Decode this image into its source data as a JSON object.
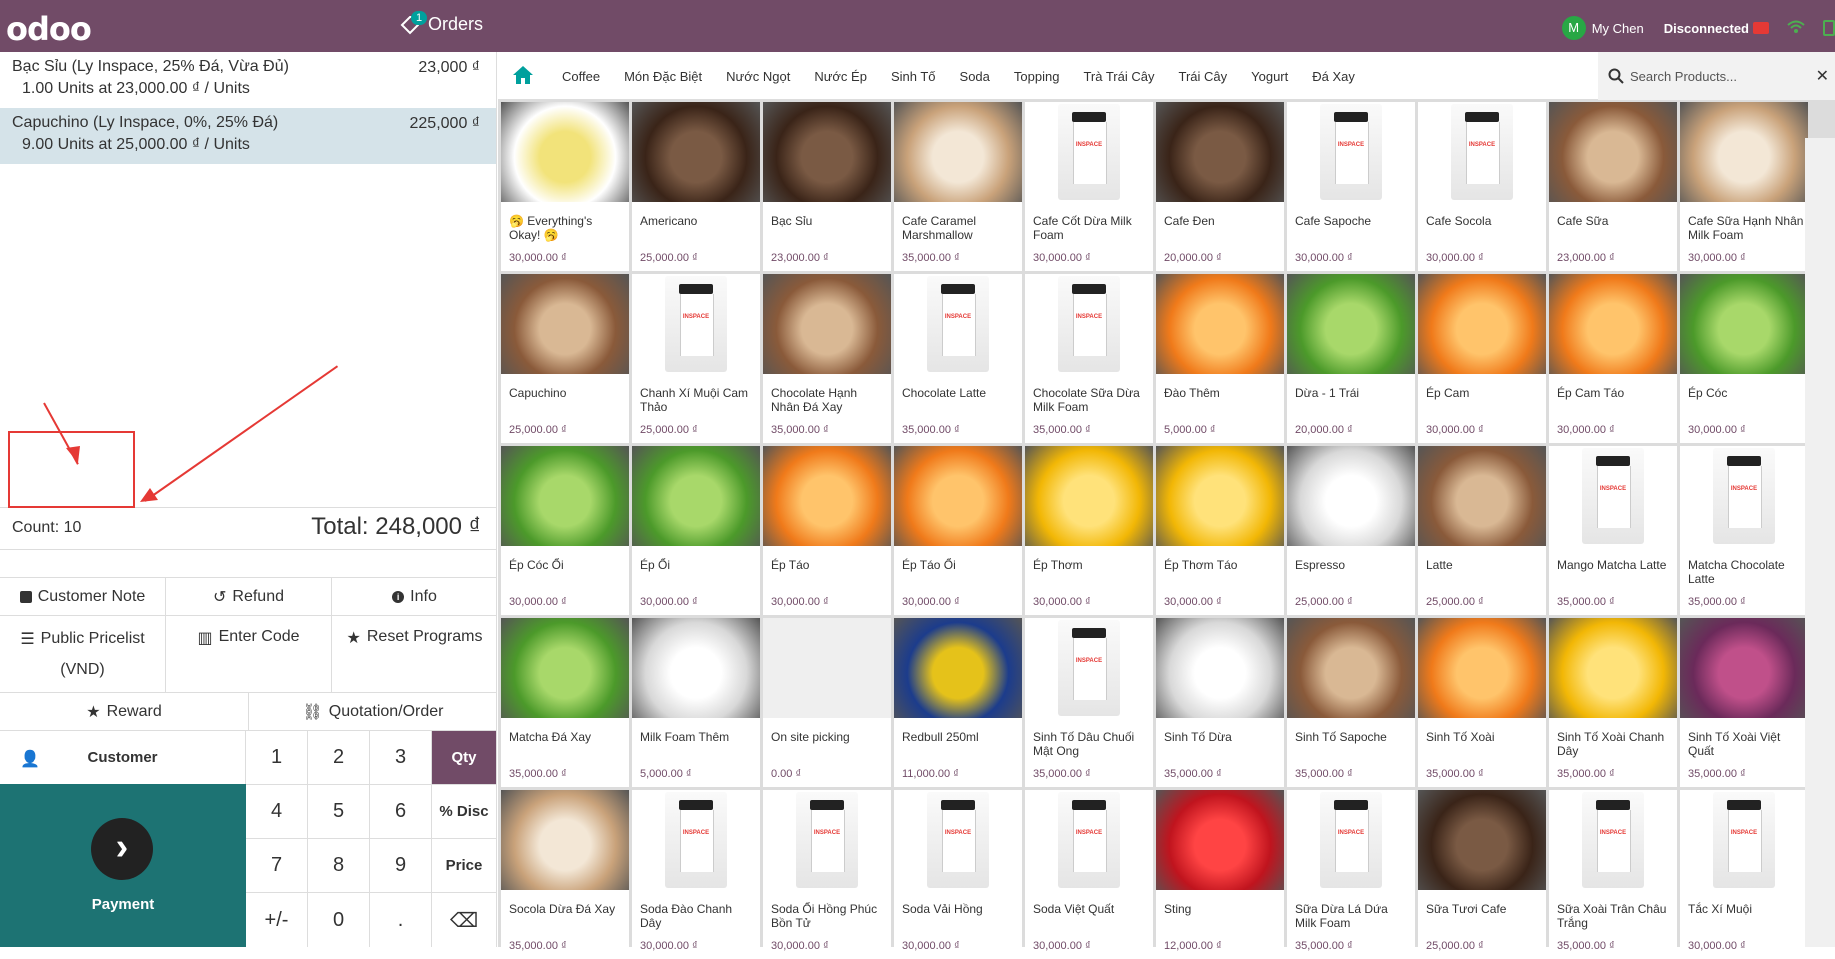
{
  "topbar": {
    "logo": "odoo",
    "orders_label": "Orders",
    "orders_badge": "1",
    "user_initial": "M",
    "user_name": "My Chen",
    "status": "Disconnected"
  },
  "order_lines": [
    {
      "name": "Bạc Sỉu (Ly Inspace, 25% Đá, Vừa Đủ)",
      "price": "23,000 ₫",
      "info": "1.00 Units at 23,000.00 ₫ / Units"
    },
    {
      "name": "Capuchino (Ly Inspace, 0%, 25% Đá)",
      "price": "225,000 ₫",
      "info": "9.00 Units at 25,000.00 ₫ / Units"
    }
  ],
  "summary": {
    "count": "Count: 10",
    "total": "Total: 248,000 ₫"
  },
  "controls": {
    "customer_note": "Customer Note",
    "refund": "Refund",
    "info": "Info",
    "public_pricelist": "Public Pricelist",
    "pricelist_currency": "(VND)",
    "enter_code": "Enter Code",
    "reset_programs": "Reset Programs",
    "reward": "Reward",
    "quotation": "Quotation/Order"
  },
  "numpad": {
    "customer": "Customer",
    "payment": "Payment",
    "keys": [
      "1",
      "2",
      "3",
      "Qty",
      "4",
      "5",
      "6",
      "% Disc",
      "7",
      "8",
      "9",
      "Price",
      "+/-",
      "0",
      ".",
      "⌫"
    ]
  },
  "categories": [
    "Coffee",
    "Món Đặc Biệt",
    "Nước Ngọt",
    "Nước Ép",
    "Sinh Tố",
    "Soda",
    "Topping",
    "Trà Trái Cây",
    "Trái Cây",
    "Yogurt",
    "Đá Xay"
  ],
  "search": {
    "placeholder": "Search Products..."
  },
  "products": [
    {
      "name": "🥱 Everything's Okay! 🥱",
      "price": "30,000.00 ₫",
      "img": "poster"
    },
    {
      "name": "Americano",
      "price": "25,000.00 ₫",
      "img": "dark"
    },
    {
      "name": "Bạc Sỉu",
      "price": "23,000.00 ₫",
      "img": "dark"
    },
    {
      "name": "Cafe Caramel Marshmallow",
      "price": "35,000.00 ₫",
      "img": "cream"
    },
    {
      "name": "Cafe Cốt Dừa Milk Foam",
      "price": "30,000.00 ₫",
      "img": "cup"
    },
    {
      "name": "Cafe Đen",
      "price": "20,000.00 ₫",
      "img": "dark"
    },
    {
      "name": "Cafe Sapoche",
      "price": "30,000.00 ₫",
      "img": "cup"
    },
    {
      "name": "Cafe Socola",
      "price": "30,000.00 ₫",
      "img": "cup"
    },
    {
      "name": "Cafe Sữa",
      "price": "23,000.00 ₫",
      "img": "brown"
    },
    {
      "name": "Cafe Sữa Hạnh Nhân Milk Foam",
      "price": "30,000.00 ₫",
      "img": "cream"
    },
    {
      "name": "Capuchino",
      "price": "25,000.00 ₫",
      "img": "brown"
    },
    {
      "name": "Chanh Xí Muội Cam Thảo",
      "price": "25,000.00 ₫",
      "img": "cup"
    },
    {
      "name": "Chocolate Hạnh Nhân Đá Xay",
      "price": "35,000.00 ₫",
      "img": "brown"
    },
    {
      "name": "Chocolate Latte",
      "price": "35,000.00 ₫",
      "img": "cup"
    },
    {
      "name": "Chocolate Sữa Dừa Milk Foam",
      "price": "35,000.00 ₫",
      "img": "cup"
    },
    {
      "name": "Đào Thêm",
      "price": "5,000.00 ₫",
      "img": "orange"
    },
    {
      "name": "Dừa - 1 Trái",
      "price": "20,000.00 ₫",
      "img": "green"
    },
    {
      "name": "Ép Cam",
      "price": "30,000.00 ₫",
      "img": "orange"
    },
    {
      "name": "Ép Cam Táo",
      "price": "30,000.00 ₫",
      "img": "orange"
    },
    {
      "name": "Ép Cóc",
      "price": "30,000.00 ₫",
      "img": "green"
    },
    {
      "name": "Ép Cóc Ổi",
      "price": "30,000.00 ₫",
      "img": "green"
    },
    {
      "name": "Ép Ổi",
      "price": "30,000.00 ₫",
      "img": "green"
    },
    {
      "name": "Ép Táo",
      "price": "30,000.00 ₫",
      "img": "orange"
    },
    {
      "name": "Ép Táo Ổi",
      "price": "30,000.00 ₫",
      "img": "orange"
    },
    {
      "name": "Ép Thơm",
      "price": "30,000.00 ₫",
      "img": "yellow"
    },
    {
      "name": "Ép Thơm Táo",
      "price": "30,000.00 ₫",
      "img": "yellow"
    },
    {
      "name": "Espresso",
      "price": "25,000.00 ₫",
      "img": "white"
    },
    {
      "name": "Latte",
      "price": "25,000.00 ₫",
      "img": "brown"
    },
    {
      "name": "Mango Matcha Latte",
      "price": "35,000.00 ₫",
      "img": "cup"
    },
    {
      "name": "Matcha Chocolate Latte",
      "price": "35,000.00 ₫",
      "img": "cup"
    },
    {
      "name": "Matcha Đá Xay",
      "price": "35,000.00 ₫",
      "img": "green"
    },
    {
      "name": "Milk Foam Thêm",
      "price": "5,000.00 ₫",
      "img": "white"
    },
    {
      "name": "On site picking",
      "price": "0.00 ₫",
      "img": "placeholder"
    },
    {
      "name": "Redbull 250ml",
      "price": "11,000.00 ₫",
      "img": "can"
    },
    {
      "name": "Sinh Tố Dâu Chuối Mật Ong",
      "price": "35,000.00 ₫",
      "img": "cup"
    },
    {
      "name": "Sinh Tố Dừa",
      "price": "35,000.00 ₫",
      "img": "white"
    },
    {
      "name": "Sinh Tố Sapoche",
      "price": "35,000.00 ₫",
      "img": "brown"
    },
    {
      "name": "Sinh Tố Xoài",
      "price": "35,000.00 ₫",
      "img": "orange"
    },
    {
      "name": "Sinh Tố Xoài Chanh Dây",
      "price": "35,000.00 ₫",
      "img": "yellow"
    },
    {
      "name": "Sinh Tố Xoài Việt Quất",
      "price": "35,000.00 ₫",
      "img": "purple"
    },
    {
      "name": "Socola Dừa Đá Xay",
      "price": "35,000.00 ₫",
      "img": "cream"
    },
    {
      "name": "Soda Đào Chanh Dây",
      "price": "30,000.00 ₫",
      "img": "cup"
    },
    {
      "name": "Soda Ổi Hồng Phúc Bồn Tử",
      "price": "30,000.00 ₫",
      "img": "cup"
    },
    {
      "name": "Soda Vải Hồng",
      "price": "30,000.00 ₫",
      "img": "cup"
    },
    {
      "name": "Soda Việt Quất",
      "price": "30,000.00 ₫",
      "img": "cup"
    },
    {
      "name": "Sting",
      "price": "12,000.00 ₫",
      "img": "red"
    },
    {
      "name": "Sữa Dừa Lá Dứa Milk Foam",
      "price": "35,000.00 ₫",
      "img": "cup"
    },
    {
      "name": "Sữa Tươi Cafe",
      "price": "25,000.00 ₫",
      "img": "dark"
    },
    {
      "name": "Sữa Xoài Trân Châu Trắng",
      "price": "35,000.00 ₫",
      "img": "cup"
    },
    {
      "name": "Tắc Xí Muội",
      "price": "30,000.00 ₫",
      "img": "cup"
    }
  ],
  "colors": {
    "brand": "#714b67",
    "payment": "#1d7373",
    "selected_line": "#d5e3e9",
    "annotation": "#e53935"
  }
}
